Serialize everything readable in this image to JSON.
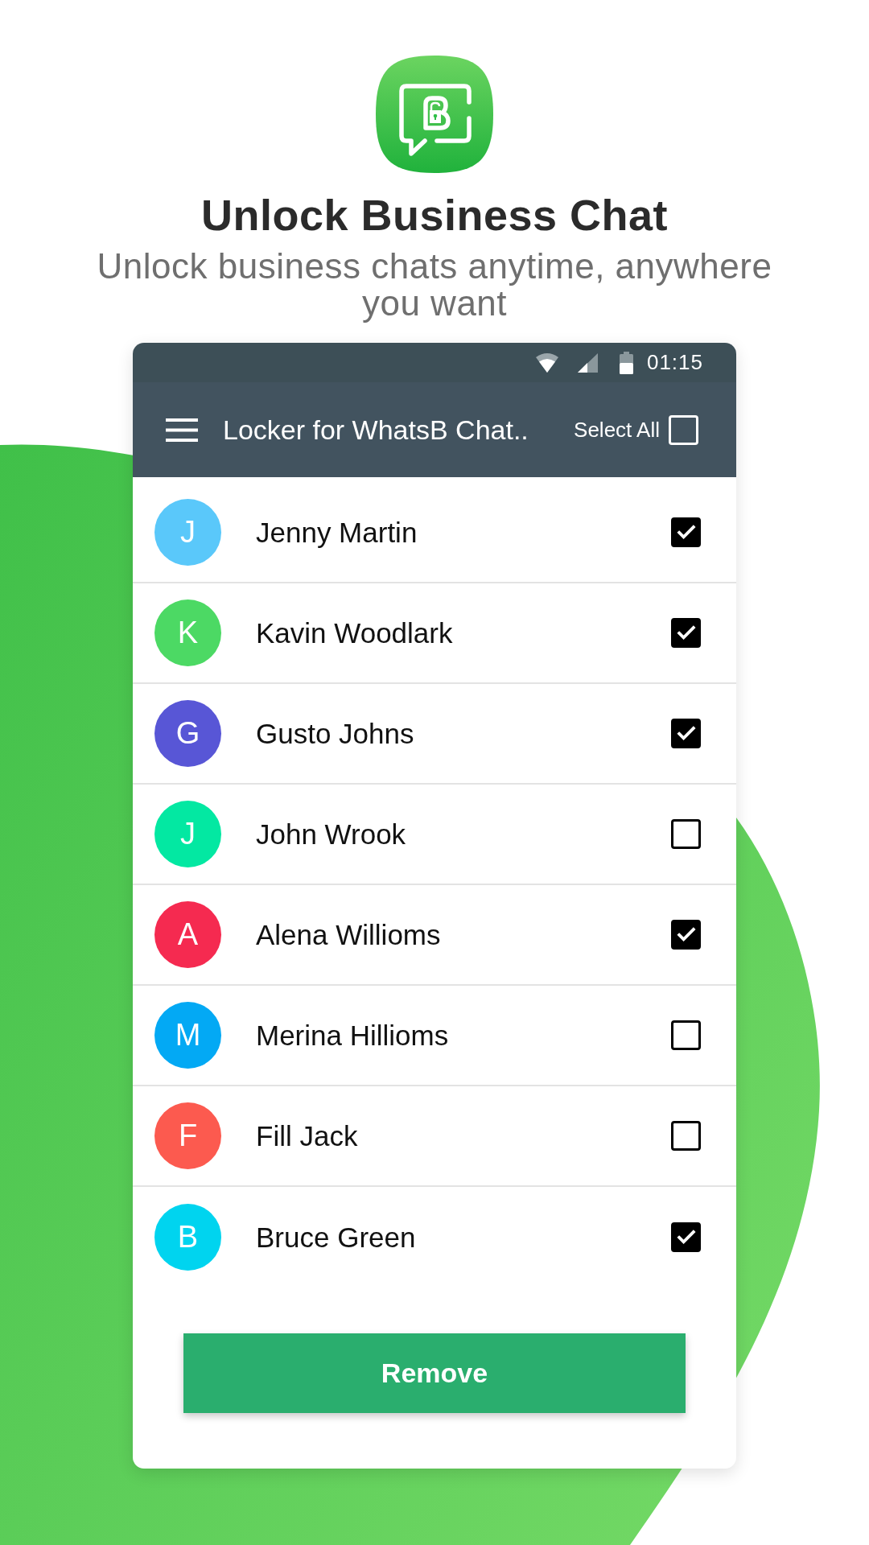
{
  "header": {
    "title": "Unlock Business Chat",
    "subtitle": "Unlock business chats anytime, anywhere you want"
  },
  "status_bar": {
    "time": "01:15"
  },
  "toolbar": {
    "title": "Locker for WhatsB Chat..",
    "select_all": {
      "label": "Select All",
      "checked": false
    }
  },
  "contacts": [
    {
      "initial": "J",
      "name": "Jenny Martin",
      "color": "#5ac8fa",
      "checked": true
    },
    {
      "initial": "K",
      "name": "Kavin Woodlark",
      "color": "#4cd964",
      "checked": true
    },
    {
      "initial": "G",
      "name": "Gusto Johns",
      "color": "#5856d6",
      "checked": true
    },
    {
      "initial": "J",
      "name": "John Wrook",
      "color": "#03e8a2",
      "checked": false
    },
    {
      "initial": "A",
      "name": "Alena Willioms",
      "color": "#f52a50",
      "checked": true
    },
    {
      "initial": "M",
      "name": "Merina Hillioms",
      "color": "#03a9f4",
      "checked": false
    },
    {
      "initial": "F",
      "name": "Fill Jack",
      "color": "#fc5a4f",
      "checked": false
    },
    {
      "initial": "B",
      "name": "Bruce Green",
      "color": "#00d4ef",
      "checked": true
    }
  ],
  "button": {
    "label": "Remove"
  }
}
